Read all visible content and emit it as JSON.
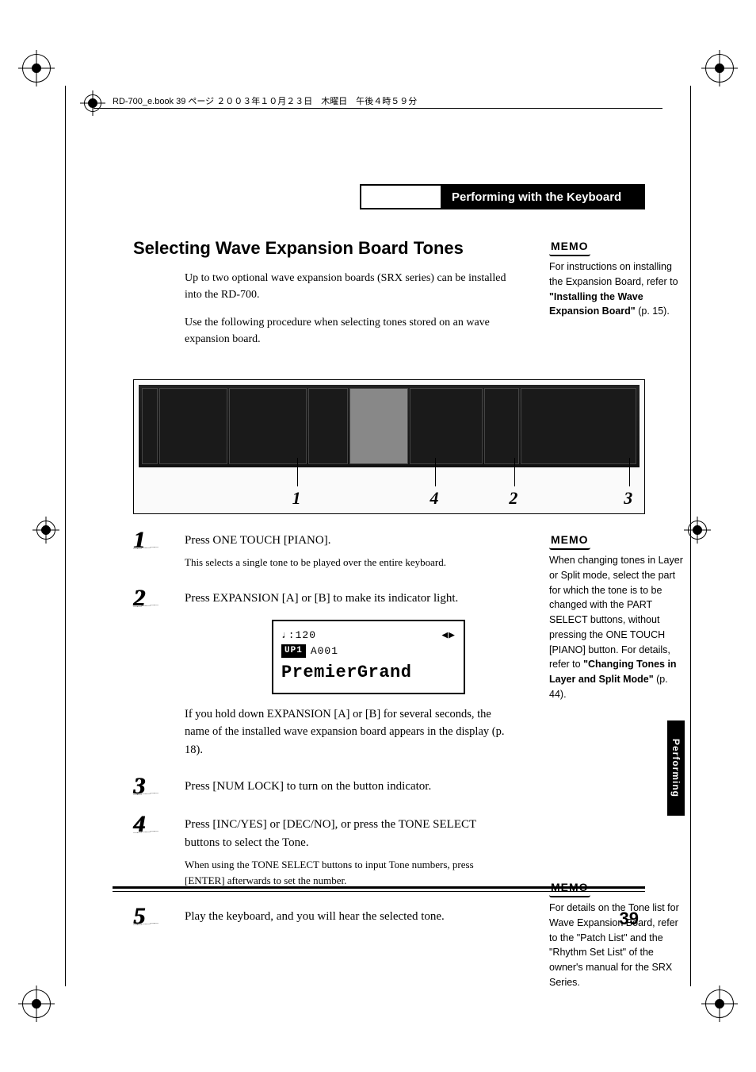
{
  "header_running": "RD-700_e.book  39 ページ  ２００３年１０月２３日　木曜日　午後４時５９分",
  "chapter_title": "Performing with the Keyboard",
  "section_title": "Selecting Wave Expansion Board Tones",
  "intro": {
    "p1": "Up to two optional wave expansion boards (SRX series) can be installed into the RD-700.",
    "p2": "Use the following procedure when selecting tones stored on an wave expansion board."
  },
  "memo_label": "MEMO",
  "memo1": {
    "lead": "For instructions on installing the Expansion Board, refer to ",
    "bold": "\"Installing the Wave Expansion Board\"",
    "tail": " (p. 15)."
  },
  "callouts": {
    "n1": "1",
    "n2": "4",
    "n3": "2",
    "n4": "3"
  },
  "steps": {
    "s1": {
      "num": "1",
      "main": "Press ONE TOUCH [PIANO].",
      "sub": "This selects a single tone to be played over the entire keyboard."
    },
    "s2": {
      "num": "2",
      "main": "Press EXPANSION [A] or [B] to make its indicator light.",
      "after": "If you hold down EXPANSION [A] or [B] for several seconds, the name of the installed wave expansion board appears in the display (p. 18)."
    },
    "s3": {
      "num": "3",
      "main": "Press [NUM LOCK] to turn on the button indicator."
    },
    "s4": {
      "num": "4",
      "main": "Press [INC/YES] or [DEC/NO], or press the TONE SELECT buttons to select the Tone.",
      "sub": "When using the TONE SELECT buttons to input Tone numbers, press [ENTER] afterwards to set the number."
    },
    "s5": {
      "num": "5",
      "main": "Play the keyboard, and you will hear the selected tone."
    }
  },
  "lcd": {
    "tempo": "♩:120",
    "arrows": "◀▶",
    "badge": "UP1",
    "patch": "A001",
    "name": "PremierGrand"
  },
  "memo2": {
    "lead": "When changing tones in Layer or Split mode, select the part for which the tone is to be changed with the PART SELECT buttons, without pressing the ONE TOUCH [PIANO] button. For details, refer to ",
    "bold": "\"Changing Tones in Layer and Split Mode\"",
    "tail": " (p. 44)."
  },
  "memo3": {
    "text": "For details on the Tone list for Wave Expansion Board, refer to the \"Patch List\" and the \"Rhythm Set List\" of the owner's manual for the SRX Series."
  },
  "side_tab": "Performing",
  "page_number": "39"
}
